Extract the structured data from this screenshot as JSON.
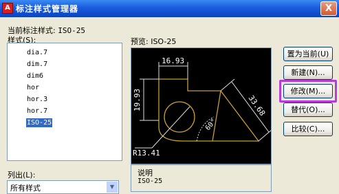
{
  "window": {
    "title": "标注样式管理器",
    "close_label": "X",
    "app_icon_glyph": "A"
  },
  "current_style": {
    "label": "当前标注样式:",
    "value": "ISO-25"
  },
  "styles_label": "样式(S):",
  "styles": [
    {
      "name": "dia.7",
      "selected": false
    },
    {
      "name": "dim.7",
      "selected": false
    },
    {
      "name": "dim6",
      "selected": false
    },
    {
      "name": "hor",
      "selected": false
    },
    {
      "name": "hor.3",
      "selected": false
    },
    {
      "name": "hor.7",
      "selected": false
    },
    {
      "name": "ISO-25",
      "selected": true
    }
  ],
  "preview": {
    "label": "预览: ISO-25",
    "dims": {
      "top": "16.93",
      "left": "19.93",
      "diagonal": "33.68",
      "angle": "60°",
      "radius": "R13.41"
    }
  },
  "description": {
    "label": "说明",
    "value": "ISO-25"
  },
  "list": {
    "label": "列出(L):",
    "value": "所有样式"
  },
  "buttons": [
    {
      "id": "set-current",
      "label": "置为当前(U)"
    },
    {
      "id": "new",
      "label": "新建(N)..."
    },
    {
      "id": "modify",
      "label": "修改(M)..."
    },
    {
      "id": "override",
      "label": "替代(O)..."
    },
    {
      "id": "compare",
      "label": "比较(C)..."
    }
  ],
  "colors": {
    "titlebar": "#1c5fe0",
    "highlight_frame": "#b53cd8",
    "selection": "#316ac5",
    "preview_geometry": "#c8a030"
  }
}
